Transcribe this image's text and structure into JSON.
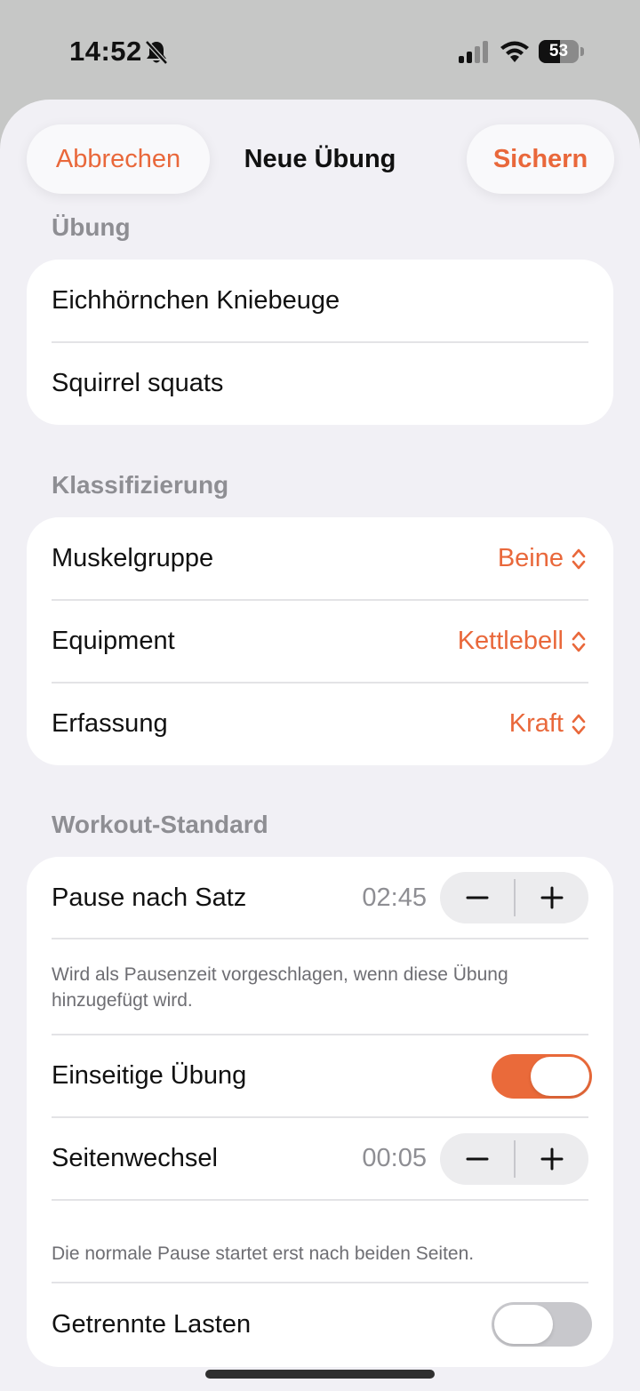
{
  "status_bar": {
    "time": "14:52",
    "battery_level": "53",
    "battery_fraction": 0.53,
    "icons": [
      "bell-slash-icon",
      "cellular-signal-icon",
      "wifi-icon",
      "battery-icon"
    ]
  },
  "nav": {
    "cancel_label": "Abbrechen",
    "title": "Neue Übung",
    "save_label": "Sichern"
  },
  "exercise_section": {
    "header": "Übung",
    "name_de": "Eichhörnchen Kniebeuge",
    "name_en": "Squirrel squats"
  },
  "classification_section": {
    "header": "Klassifizierung",
    "rows": [
      {
        "label": "Muskelgruppe",
        "value": "Beine"
      },
      {
        "label": "Equipment",
        "value": "Kettlebell"
      },
      {
        "label": "Erfassung",
        "value": "Kraft"
      }
    ]
  },
  "workout_section": {
    "header": "Workout-Standard",
    "rest_label": "Pause nach Satz",
    "rest_value": "02:45",
    "rest_note": "Wird als Pausenzeit vorgeschlagen, wenn diese Übung hinzugefügt wird.",
    "unilateral_label": "Einseitige Übung",
    "unilateral_on": true,
    "switch_label": "Seitenwechsel",
    "switch_value": "00:05",
    "switch_note": "Die normale Pause startet erst nach beiden Seiten.",
    "separate_loads_label": "Getrennte Lasten",
    "separate_loads_on": false
  },
  "colors": {
    "accent": "#e9683b",
    "sheet_background": "#f1f0f5",
    "card_background": "#ffffff",
    "secondary_text": "#8e8e93",
    "toggle_off": "#c8c8cc"
  }
}
